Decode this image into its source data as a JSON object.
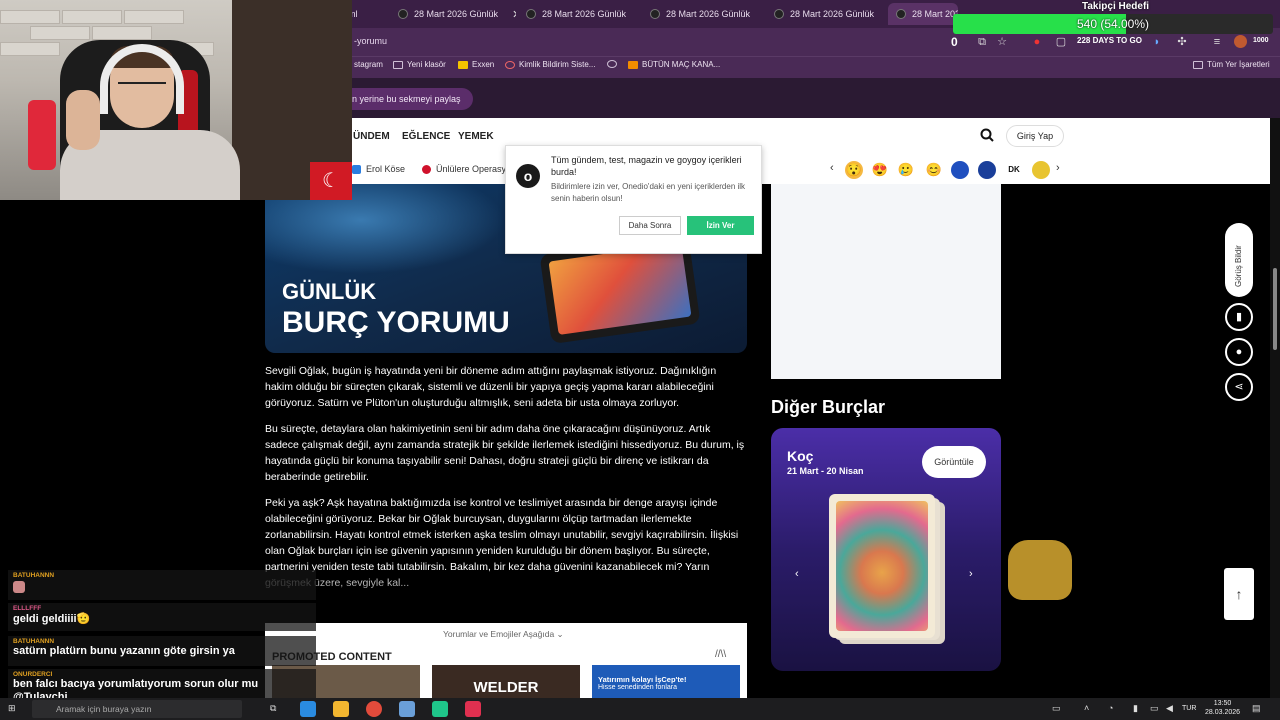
{
  "browser": {
    "tabs": [
      {
        "label": "ml"
      },
      {
        "label": "28 Mart 2026 Günlük"
      },
      {
        "label": "28 Mart 2026 Günlük"
      },
      {
        "label": "28 Mart 2026 Günlük"
      },
      {
        "label": "28 Mart 2026 Günlük"
      },
      {
        "label": "28 Mart 2026 Günlük"
      },
      {
        "label": "28 Mart 2026 Günlük"
      }
    ],
    "url": "-yorumu",
    "bookmarks": [
      "stagram",
      "Yeni klasör",
      "Exxen",
      "Kimlik Bildirim Siste...",
      "BÜTÜN MAÇ KANA..."
    ],
    "all_bookmarks": "Tüm Yer İşaretleri",
    "share_chip": "n yerine bu sekmeyi paylaş",
    "days_badge": "228 DAYS TO GO",
    "counter_top": "1000"
  },
  "overlay": {
    "goal_title": "Takipçi Hedefi",
    "goal_text": "540 (54.00%)",
    "goal_fraction": 0.54,
    "counter": "0"
  },
  "site": {
    "nav": [
      "ÜNDEM",
      "EĞLENCE",
      "YEMEK"
    ],
    "login": "Giriş Yap",
    "stories": [
      "Erol Köse",
      "Ünlülere Operasy"
    ],
    "emojis": [
      "😯",
      "😍",
      "🥲",
      "😊"
    ],
    "emoji_badges": [
      "DK"
    ]
  },
  "notification": {
    "title": "Tüm gündem, test, magazin ve goygoy içerikleri burda!",
    "body": "Bildirimlere izin ver, Onedio'daki en yeni içeriklerden ilk senin haberin olsun!",
    "later": "Daha Sonra",
    "allow": "İzin Ver",
    "logo": "o"
  },
  "article": {
    "hero_line1": "GÜNLÜK",
    "hero_line2": "BURÇ YORUMU",
    "p1": "Sevgili Oğlak, bugün iş hayatında yeni bir döneme adım attığını paylaşmak istiyoruz. Dağınıklığın hakim olduğu bir süreçten çıkarak, sistemli ve düzenli bir yapıya geçiş yapma kararı alabileceğini görüyoruz. Satürn ve Plüton'un oluşturduğu altmışlık, seni adeta bir usta olmaya zorluyor.",
    "p2": "Bu süreçte, detaylara olan hakimiyetinin seni bir adım daha öne çıkaracağını düşünüyoruz. Artık sadece çalışmak değil, aynı zamanda stratejik bir şekilde ilerlemek istediğini hissediyoruz. Bu durum, iş hayatında güçlü bir konuma taşıyabilir seni! Dahası, doğru strateji güçlü bir direnç ve istikrarı da beraberinde getirebilir.",
    "p3": "Peki ya aşk? Aşk hayatına baktığımızda ise kontrol ve teslimiyet arasında bir denge arayışı içinde olabileceğini görüyoruz. Bekar bir Oğlak burcuysan, duygularını ölçüp tartmadan ilerlemekte zorlanabilirsin. Hayatı kontrol etmek isterken aşka teslim olmayı unutabilir, sevgiyi kaçırabilirsin. İlişkisi olan Oğlak burçları için ise güvenin yapısının yeniden kurulduğu bir dönem başlıyor. Bu süreçte, partnerini yeniden teste tabi tutabilirsin. Bakalım, bir kez daha güvenini kazanabilecek mi? Yarın görüşmek üzere, sevgiyle kal..."
  },
  "promo": {
    "toggle": "Yorumlar ve Emojiler Aşağıda ⌄",
    "title": "PROMOTED CONTENT",
    "logo": "//\\\\",
    "welder": "WELDER",
    "bank_line1": "Yatırımın kolayı İşCep'te!",
    "bank_line2": "Hisse senedinden fonlara"
  },
  "sidebar": {
    "other_title": "Diğer Burçlar",
    "card_name": "Koç",
    "card_dates": "21 Mart - 20 Nisan",
    "card_button": "Görüntüle",
    "report": "Görüş Bildir"
  },
  "chat": [
    {
      "user": "BATUHANNN",
      "text": "",
      "color": "#e0a020"
    },
    {
      "user": "ELLLFFF",
      "text": "geldi geldiiii🫡",
      "color": "#e05a8a"
    },
    {
      "user": "BATUHANNN",
      "text": "satürn platürn bunu yazanın göte girsin ya",
      "color": "#e0a020"
    },
    {
      "user": "ONURDERCI",
      "text": "ben falcı bacıya yorumlatıyorum sorun olur mu @Tulaychi",
      "color": "#e0a020"
    }
  ],
  "taskbar": {
    "search": "Aramak için buraya yazın",
    "lang": "TUR",
    "time": "13:50",
    "date": "28.03.2026"
  }
}
